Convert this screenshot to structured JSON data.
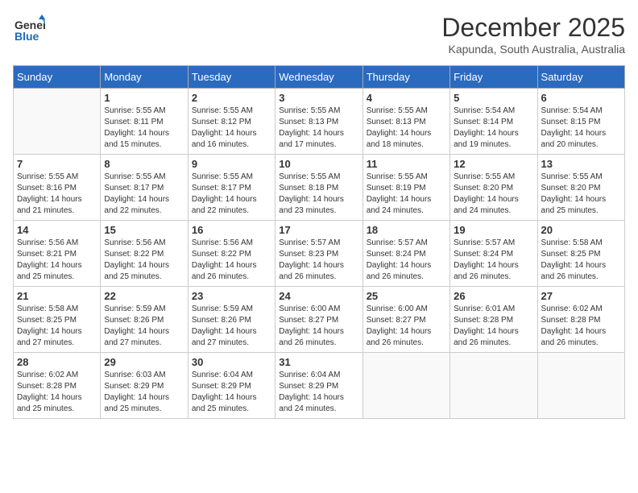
{
  "logo": {
    "general": "General",
    "blue": "Blue"
  },
  "header": {
    "month_title": "December 2025",
    "subtitle": "Kapunda, South Australia, Australia"
  },
  "calendar": {
    "days_of_week": [
      "Sunday",
      "Monday",
      "Tuesday",
      "Wednesday",
      "Thursday",
      "Friday",
      "Saturday"
    ],
    "weeks": [
      [
        {
          "day": "",
          "sunrise": "",
          "sunset": "",
          "daylight": ""
        },
        {
          "day": "1",
          "sunrise": "Sunrise: 5:55 AM",
          "sunset": "Sunset: 8:11 PM",
          "daylight": "Daylight: 14 hours and 15 minutes."
        },
        {
          "day": "2",
          "sunrise": "Sunrise: 5:55 AM",
          "sunset": "Sunset: 8:12 PM",
          "daylight": "Daylight: 14 hours and 16 minutes."
        },
        {
          "day": "3",
          "sunrise": "Sunrise: 5:55 AM",
          "sunset": "Sunset: 8:13 PM",
          "daylight": "Daylight: 14 hours and 17 minutes."
        },
        {
          "day": "4",
          "sunrise": "Sunrise: 5:55 AM",
          "sunset": "Sunset: 8:13 PM",
          "daylight": "Daylight: 14 hours and 18 minutes."
        },
        {
          "day": "5",
          "sunrise": "Sunrise: 5:54 AM",
          "sunset": "Sunset: 8:14 PM",
          "daylight": "Daylight: 14 hours and 19 minutes."
        },
        {
          "day": "6",
          "sunrise": "Sunrise: 5:54 AM",
          "sunset": "Sunset: 8:15 PM",
          "daylight": "Daylight: 14 hours and 20 minutes."
        }
      ],
      [
        {
          "day": "7",
          "sunrise": "Sunrise: 5:55 AM",
          "sunset": "Sunset: 8:16 PM",
          "daylight": "Daylight: 14 hours and 21 minutes."
        },
        {
          "day": "8",
          "sunrise": "Sunrise: 5:55 AM",
          "sunset": "Sunset: 8:17 PM",
          "daylight": "Daylight: 14 hours and 22 minutes."
        },
        {
          "day": "9",
          "sunrise": "Sunrise: 5:55 AM",
          "sunset": "Sunset: 8:17 PM",
          "daylight": "Daylight: 14 hours and 22 minutes."
        },
        {
          "day": "10",
          "sunrise": "Sunrise: 5:55 AM",
          "sunset": "Sunset: 8:18 PM",
          "daylight": "Daylight: 14 hours and 23 minutes."
        },
        {
          "day": "11",
          "sunrise": "Sunrise: 5:55 AM",
          "sunset": "Sunset: 8:19 PM",
          "daylight": "Daylight: 14 hours and 24 minutes."
        },
        {
          "day": "12",
          "sunrise": "Sunrise: 5:55 AM",
          "sunset": "Sunset: 8:20 PM",
          "daylight": "Daylight: 14 hours and 24 minutes."
        },
        {
          "day": "13",
          "sunrise": "Sunrise: 5:55 AM",
          "sunset": "Sunset: 8:20 PM",
          "daylight": "Daylight: 14 hours and 25 minutes."
        }
      ],
      [
        {
          "day": "14",
          "sunrise": "Sunrise: 5:56 AM",
          "sunset": "Sunset: 8:21 PM",
          "daylight": "Daylight: 14 hours and 25 minutes."
        },
        {
          "day": "15",
          "sunrise": "Sunrise: 5:56 AM",
          "sunset": "Sunset: 8:22 PM",
          "daylight": "Daylight: 14 hours and 25 minutes."
        },
        {
          "day": "16",
          "sunrise": "Sunrise: 5:56 AM",
          "sunset": "Sunset: 8:22 PM",
          "daylight": "Daylight: 14 hours and 26 minutes."
        },
        {
          "day": "17",
          "sunrise": "Sunrise: 5:57 AM",
          "sunset": "Sunset: 8:23 PM",
          "daylight": "Daylight: 14 hours and 26 minutes."
        },
        {
          "day": "18",
          "sunrise": "Sunrise: 5:57 AM",
          "sunset": "Sunset: 8:24 PM",
          "daylight": "Daylight: 14 hours and 26 minutes."
        },
        {
          "day": "19",
          "sunrise": "Sunrise: 5:57 AM",
          "sunset": "Sunset: 8:24 PM",
          "daylight": "Daylight: 14 hours and 26 minutes."
        },
        {
          "day": "20",
          "sunrise": "Sunrise: 5:58 AM",
          "sunset": "Sunset: 8:25 PM",
          "daylight": "Daylight: 14 hours and 26 minutes."
        }
      ],
      [
        {
          "day": "21",
          "sunrise": "Sunrise: 5:58 AM",
          "sunset": "Sunset: 8:25 PM",
          "daylight": "Daylight: 14 hours and 27 minutes."
        },
        {
          "day": "22",
          "sunrise": "Sunrise: 5:59 AM",
          "sunset": "Sunset: 8:26 PM",
          "daylight": "Daylight: 14 hours and 27 minutes."
        },
        {
          "day": "23",
          "sunrise": "Sunrise: 5:59 AM",
          "sunset": "Sunset: 8:26 PM",
          "daylight": "Daylight: 14 hours and 27 minutes."
        },
        {
          "day": "24",
          "sunrise": "Sunrise: 6:00 AM",
          "sunset": "Sunset: 8:27 PM",
          "daylight": "Daylight: 14 hours and 26 minutes."
        },
        {
          "day": "25",
          "sunrise": "Sunrise: 6:00 AM",
          "sunset": "Sunset: 8:27 PM",
          "daylight": "Daylight: 14 hours and 26 minutes."
        },
        {
          "day": "26",
          "sunrise": "Sunrise: 6:01 AM",
          "sunset": "Sunset: 8:28 PM",
          "daylight": "Daylight: 14 hours and 26 minutes."
        },
        {
          "day": "27",
          "sunrise": "Sunrise: 6:02 AM",
          "sunset": "Sunset: 8:28 PM",
          "daylight": "Daylight: 14 hours and 26 minutes."
        }
      ],
      [
        {
          "day": "28",
          "sunrise": "Sunrise: 6:02 AM",
          "sunset": "Sunset: 8:28 PM",
          "daylight": "Daylight: 14 hours and 25 minutes."
        },
        {
          "day": "29",
          "sunrise": "Sunrise: 6:03 AM",
          "sunset": "Sunset: 8:29 PM",
          "daylight": "Daylight: 14 hours and 25 minutes."
        },
        {
          "day": "30",
          "sunrise": "Sunrise: 6:04 AM",
          "sunset": "Sunset: 8:29 PM",
          "daylight": "Daylight: 14 hours and 25 minutes."
        },
        {
          "day": "31",
          "sunrise": "Sunrise: 6:04 AM",
          "sunset": "Sunset: 8:29 PM",
          "daylight": "Daylight: 14 hours and 24 minutes."
        },
        {
          "day": "",
          "sunrise": "",
          "sunset": "",
          "daylight": ""
        },
        {
          "day": "",
          "sunrise": "",
          "sunset": "",
          "daylight": ""
        },
        {
          "day": "",
          "sunrise": "",
          "sunset": "",
          "daylight": ""
        }
      ]
    ]
  }
}
